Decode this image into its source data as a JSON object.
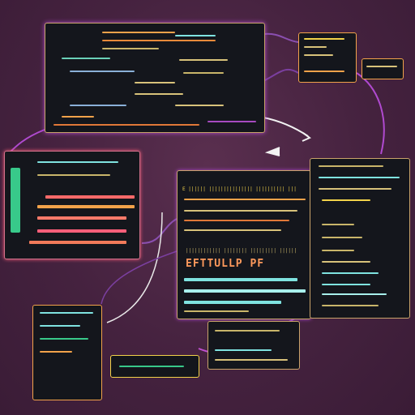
{
  "labels": {
    "center_heading": "EFTTULLP PF",
    "center_top": "E  ||||||  |||||||||||||||  ||||||||||  |||",
    "center_caption": "||||||||||||  ||||||||  |||||||||  ||||||"
  },
  "colors": {
    "background": "#45223f",
    "panel": "#14161c",
    "accent_orange": "#f2a24a",
    "accent_purple": "#b04ad0",
    "accent_cyan": "#7fe3e0",
    "accent_green": "#38c98a",
    "accent_pink": "#ff5f7a"
  },
  "icons": [
    "arrow-right-icon",
    "arrow-left-icon",
    "arrow-curved-icon"
  ]
}
